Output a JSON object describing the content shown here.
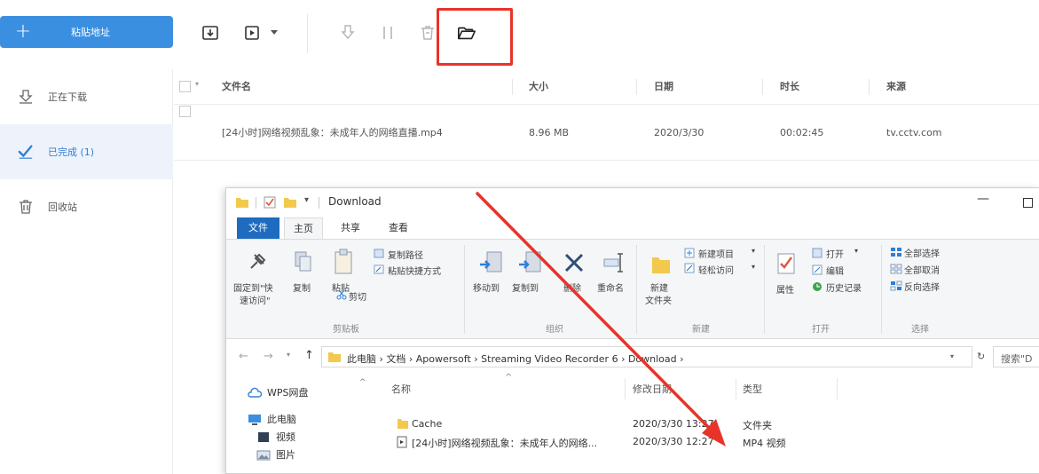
{
  "toolbar": {
    "paste_label": "粘贴地址",
    "plus": "+"
  },
  "sidebar": {
    "items": [
      {
        "label": "正在下载",
        "icon": "download-icon"
      },
      {
        "label": "已完成 (1)",
        "icon": "check-icon"
      },
      {
        "label": "回收站",
        "icon": "trash-icon"
      }
    ]
  },
  "list": {
    "columns": [
      "文件名",
      "大小",
      "日期",
      "时长",
      "来源"
    ],
    "rows": [
      {
        "name": "[24小时]网络视频乱象：未成年人的网络直播.mp4",
        "size": "8.96 MB",
        "date": "2020/3/30",
        "duration": "00:02:45",
        "source": "tv.cctv.com"
      }
    ]
  },
  "explorer": {
    "title": "Download",
    "tabs": [
      "文件",
      "主页",
      "共享",
      "查看"
    ],
    "ribbon": {
      "pin": "固定到\"快",
      "pin2": "速访问\"",
      "copy": "复制",
      "paste": "粘贴",
      "copy_path": "复制路径",
      "paste_shortcut": "粘贴快捷方式",
      "cut": "剪切",
      "group_clipboard": "剪贴板",
      "move_to": "移动到",
      "copy_to": "复制到",
      "delete": "删除",
      "rename": "重命名",
      "group_organize": "组织",
      "new_folder": "新建",
      "new_folder2": "文件夹",
      "new_item": "新建项目",
      "easy_access": "轻松访问",
      "group_new": "新建",
      "properties": "属性",
      "open": "打开",
      "edit": "编辑",
      "history": "历史记录",
      "group_open": "打开",
      "select_all": "全部选择",
      "select_none": "全部取消",
      "invert": "反向选择",
      "group_select": "选择"
    },
    "address": "此电脑  ›  文档  ›  Apowersoft  ›  Streaming Video Recorder 6  ›  Download  ›",
    "search_placeholder": "搜索\"D",
    "nav": [
      "WPS网盘",
      "此电脑",
      "视频",
      "图片"
    ],
    "file_columns": [
      "名称",
      "修改日期",
      "类型"
    ],
    "files": [
      {
        "name": "Cache",
        "date": "2020/3/30 13:27",
        "type": "文件夹"
      },
      {
        "name": "[24小时]网络视频乱象：未成年人的网络...",
        "date": "2020/3/30 12:27",
        "type": "MP4 视频"
      }
    ]
  },
  "colors": {
    "accent": "#3b8fe0",
    "highlight": "#e8332a",
    "arrow": "#e8332a",
    "ribbon_file_tab": "#1f6bbf"
  }
}
